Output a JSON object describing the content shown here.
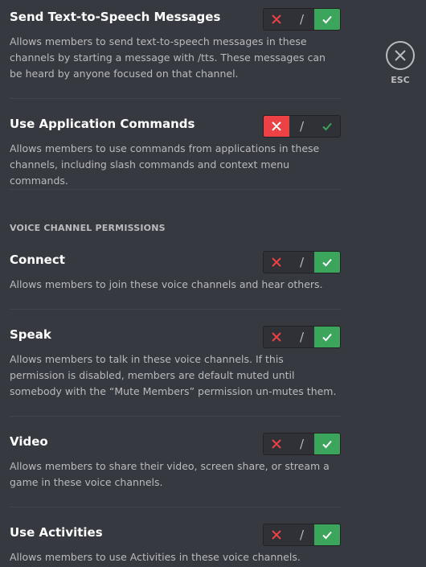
{
  "permissions": [
    {
      "title": "Send Text-to-Speech Messages",
      "description": "Allows members to send text-to-speech messages in these channels by starting a message with /tts. These messages can be heard by anyone focused on that channel.",
      "state": "allow"
    },
    {
      "title": "Use Application Commands",
      "description": "Allows members to use commands from applications in these channels, including slash commands and context menu commands.",
      "state": "deny"
    }
  ],
  "voice_section": {
    "header": "VOICE CHANNEL PERMISSIONS",
    "permissions": [
      {
        "title": "Connect",
        "description": "Allows members to join these voice channels and hear others.",
        "state": "allow"
      },
      {
        "title": "Speak",
        "description": "Allows members to talk in these voice channels. If this permission is disabled, members are default muted until somebody with the “Mute Members” permission un-mutes them.",
        "state": "allow"
      },
      {
        "title": "Video",
        "description": "Allows members to share their video, screen share, or stream a game in these voice channels.",
        "state": "allow"
      },
      {
        "title": "Use Activities",
        "description": "Allows members to use Activities in these voice channels.",
        "state": "allow"
      }
    ]
  },
  "toggle": {
    "separator": "/",
    "deny_icon": "x-icon",
    "allow_icon": "check-icon"
  },
  "close": {
    "label": "ESC",
    "icon": "close-icon"
  },
  "colors": {
    "background": "#36393f",
    "deny_active": "#ed4245",
    "allow_active": "#3ba55c",
    "deny_inactive": "#ed4245",
    "allow_inactive": "#3ba55c",
    "neutral": "#b9bbbe"
  }
}
